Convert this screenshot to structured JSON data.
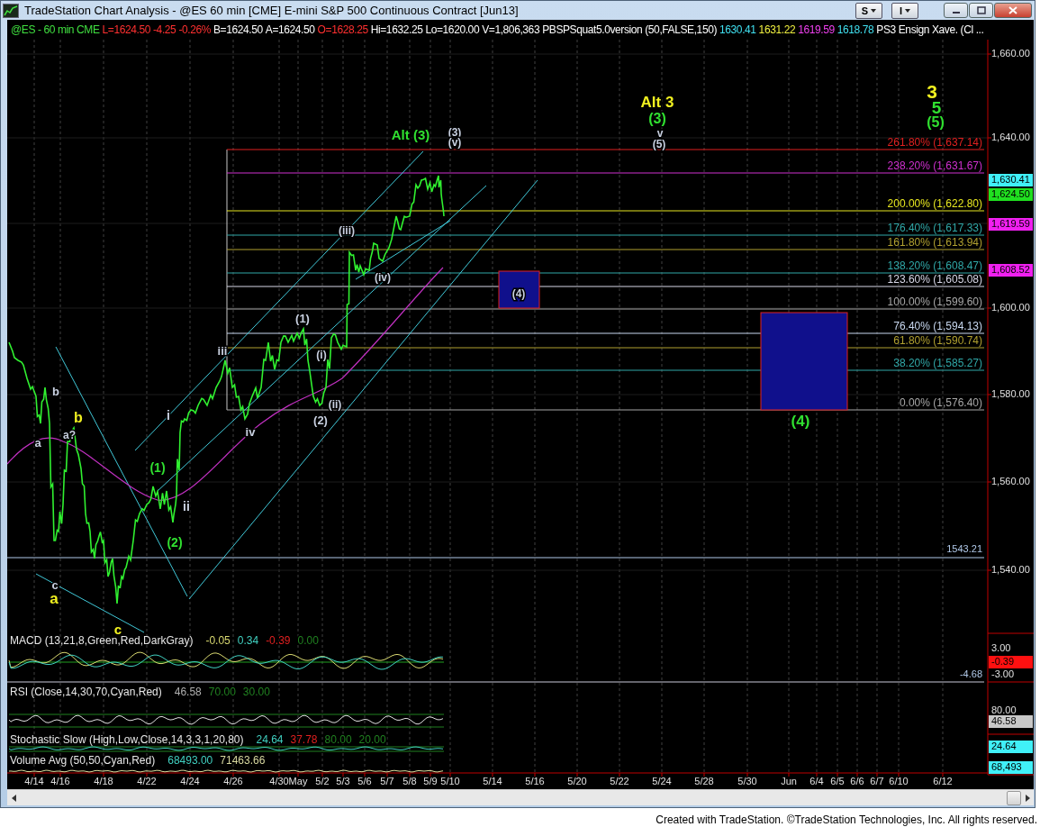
{
  "window": {
    "title": "TradeStation Chart Analysis - @ES 60 min [CME] E-mini S&P 500 Continuous Contract [Jun13]",
    "menus": [
      {
        "label": "S"
      },
      {
        "label": "I"
      }
    ]
  },
  "info_bar": [
    {
      "text": "@ES - 60 min",
      "color": "#40e040"
    },
    {
      "text": "CME",
      "color": "#40e040"
    },
    {
      "text": "L=1624.50",
      "color": "#ff3030"
    },
    {
      "text": "-4.25",
      "color": "#ff3030"
    },
    {
      "text": "-0.26%",
      "color": "#ff3030"
    },
    {
      "text": "B=1624.50",
      "color": "#ffffff"
    },
    {
      "text": "A=1624.50",
      "color": "#ffffff"
    },
    {
      "text": "O=1628.25",
      "color": "#ff3030"
    },
    {
      "text": "Hi=1632.25",
      "color": "#ffffff"
    },
    {
      "text": "Lo=1620.00",
      "color": "#ffffff"
    },
    {
      "text": "V=1,806,363",
      "color": "#ffffff"
    },
    {
      "text": "PBSPSquat5.0version (50,FALSE,150)",
      "color": "#ffffff"
    },
    {
      "text": "1630.41",
      "color": "#40e0f0"
    },
    {
      "text": "1631.22",
      "color": "#f0f040"
    },
    {
      "text": "1619.59",
      "color": "#f040f0"
    },
    {
      "text": "1618.78",
      "color": "#40e0f0"
    },
    {
      "text": "PS3 Ensign Xave. (Cl ...",
      "color": "#ffffff"
    }
  ],
  "price_chart": {
    "price_axis": [
      "1,660.00",
      "1,640.00",
      "1,600.00",
      "1,580.00",
      "1,560.00",
      "1,540.00"
    ],
    "price_tags": [
      {
        "text": "1,630.41",
        "color": "#40f0f8"
      },
      {
        "text": "1,624.50",
        "color": "#20e020"
      },
      {
        "text": "1,619.59",
        "color": "#f020f0"
      },
      {
        "text": "1,608.52",
        "color": "#f020f0"
      }
    ],
    "fib_levels": [
      {
        "label": "261.80% (1,637.14)",
        "color": "#e02020"
      },
      {
        "label": "238.20% (1,631.67)",
        "color": "#d030d0"
      },
      {
        "label": "200.00% (1,622.80)",
        "color": "#e8e820"
      },
      {
        "label": "176.40% (1,617.33)",
        "color": "#30a8a8"
      },
      {
        "label": "161.80% (1,613.94)",
        "color": "#b0a030"
      },
      {
        "label": "138.20% (1,608.47)",
        "color": "#30a8a8"
      },
      {
        "label": "123.60% (1,605.08)",
        "color": "#d8d8e8"
      },
      {
        "label": "100.00% (1,599.60)",
        "color": "#a8a8a8"
      },
      {
        "label": "76.40% (1,594.13)",
        "color": "#c8d8f0"
      },
      {
        "label": "61.80% (1,590.74)",
        "color": "#b0a030"
      },
      {
        "label": "38.20% (1,585.27)",
        "color": "#30a8a8"
      },
      {
        "label": "0.00% (1,576.40)",
        "color": "#a8a8a8"
      }
    ],
    "support_line_label": "1543.21",
    "wave_labels": [
      {
        "text": "Alt 3",
        "color": "#f0f020"
      },
      {
        "text": "(3)",
        "color": "#30e030"
      },
      {
        "text": "v",
        "color": "#c8d0e0"
      },
      {
        "text": "(5)",
        "color": "#c8d0e0"
      },
      {
        "text": "3",
        "color": "#f0f020"
      },
      {
        "text": "5",
        "color": "#30e030"
      },
      {
        "text": "(5)",
        "color": "#30e030"
      },
      {
        "text": "Alt (3)",
        "color": "#30e030"
      },
      {
        "text": "(3)",
        "color": "#c8d0e0"
      },
      {
        "text": "(v)",
        "color": "#c8d0e0"
      },
      {
        "text": "(iii)",
        "color": "#c8d0e0"
      },
      {
        "text": "(iv)",
        "color": "#c8d0e0"
      },
      {
        "text": "(4)",
        "color": "#c8d0e0"
      },
      {
        "text": "(1)",
        "color": "#c8d0e0"
      },
      {
        "text": "(i)",
        "color": "#c8d0e0"
      },
      {
        "text": "iii",
        "color": "#c8d0e0"
      },
      {
        "text": "(ii)",
        "color": "#c8d0e0"
      },
      {
        "text": "(2)",
        "color": "#c8d0e0"
      },
      {
        "text": "i",
        "color": "#c8d0e0"
      },
      {
        "text": "iv",
        "color": "#c8d0e0"
      },
      {
        "text": "(4)",
        "color": "#30e030"
      },
      {
        "text": "b",
        "color": "#c8d0e0"
      },
      {
        "text": "b",
        "color": "#f0f020"
      },
      {
        "text": "a?",
        "color": "#c8d0e0"
      },
      {
        "text": "a",
        "color": "#c8d0e0"
      },
      {
        "text": "(1)",
        "color": "#30e030"
      },
      {
        "text": "ii",
        "color": "#c8d0e0"
      },
      {
        "text": "(2)",
        "color": "#30e030"
      },
      {
        "text": "c",
        "color": "#c8d0e0"
      },
      {
        "text": "a",
        "color": "#f0f020"
      },
      {
        "text": "c",
        "color": "#f0f020"
      }
    ]
  },
  "indicators": [
    {
      "title": "MACD (13,21,8,Green,Red,DarkGray)",
      "values": [
        {
          "text": "-0.05",
          "color": "#d8d870"
        },
        {
          "text": "0.34",
          "color": "#40d0c0"
        },
        {
          "text": "-0.39",
          "color": "#e02020"
        },
        {
          "text": "0.00",
          "color": "#208020"
        }
      ]
    },
    {
      "title": "RSI (Close,14,30,70,Cyan,Red)",
      "values": [
        {
          "text": "46.58",
          "color": "#b0b0b0"
        },
        {
          "text": "70.00",
          "color": "#208020"
        },
        {
          "text": "30.00",
          "color": "#208020"
        }
      ]
    },
    {
      "title": "Stochastic Slow (High,Low,Close,14,3,3,1,20,80)",
      "values": [
        {
          "text": "24.64",
          "color": "#40d0c0"
        },
        {
          "text": "37.78",
          "color": "#e02020"
        },
        {
          "text": "80.00",
          "color": "#208020"
        },
        {
          "text": "20.00",
          "color": "#208020"
        }
      ]
    },
    {
      "title": "Volume Avg (50,50,Cyan,Red)",
      "values": [
        {
          "text": "68493.00",
          "color": "#40d0c0"
        },
        {
          "text": "71463.66",
          "color": "#d8d8a0"
        }
      ]
    }
  ],
  "macd_level_label": "-4.68",
  "indicator_axis": [
    {
      "kind": "label",
      "text": "3.00"
    },
    {
      "kind": "tag",
      "text": "-0.39",
      "color": "#ff1010"
    },
    {
      "kind": "label",
      "text": "-3.00"
    },
    {
      "kind": "label",
      "text": "80.00"
    },
    {
      "kind": "tag",
      "text": "46.58",
      "color": "#c8c8c8"
    },
    {
      "kind": "tag",
      "text": "24.64",
      "color": "#40f0f8"
    },
    {
      "kind": "tag",
      "text": "68,493",
      "color": "#40f0f8"
    }
  ],
  "time_axis": [
    "4/14",
    "4/16",
    "4/18",
    "4/22",
    "4/24",
    "4/26",
    "4/30",
    "May",
    "5/2",
    "5/3",
    "5/6",
    "5/7",
    "5/8",
    "5/9",
    "5/10",
    "5/14",
    "5/16",
    "5/20",
    "5/22",
    "5/24",
    "5/28",
    "5/30",
    "Jun",
    "6/4",
    "6/5",
    "6/6",
    "6/7",
    "6/10",
    "6/12"
  ],
  "footer": "Created with TradeStation. ©TradeStation Technologies, Inc. All rights reserved."
}
